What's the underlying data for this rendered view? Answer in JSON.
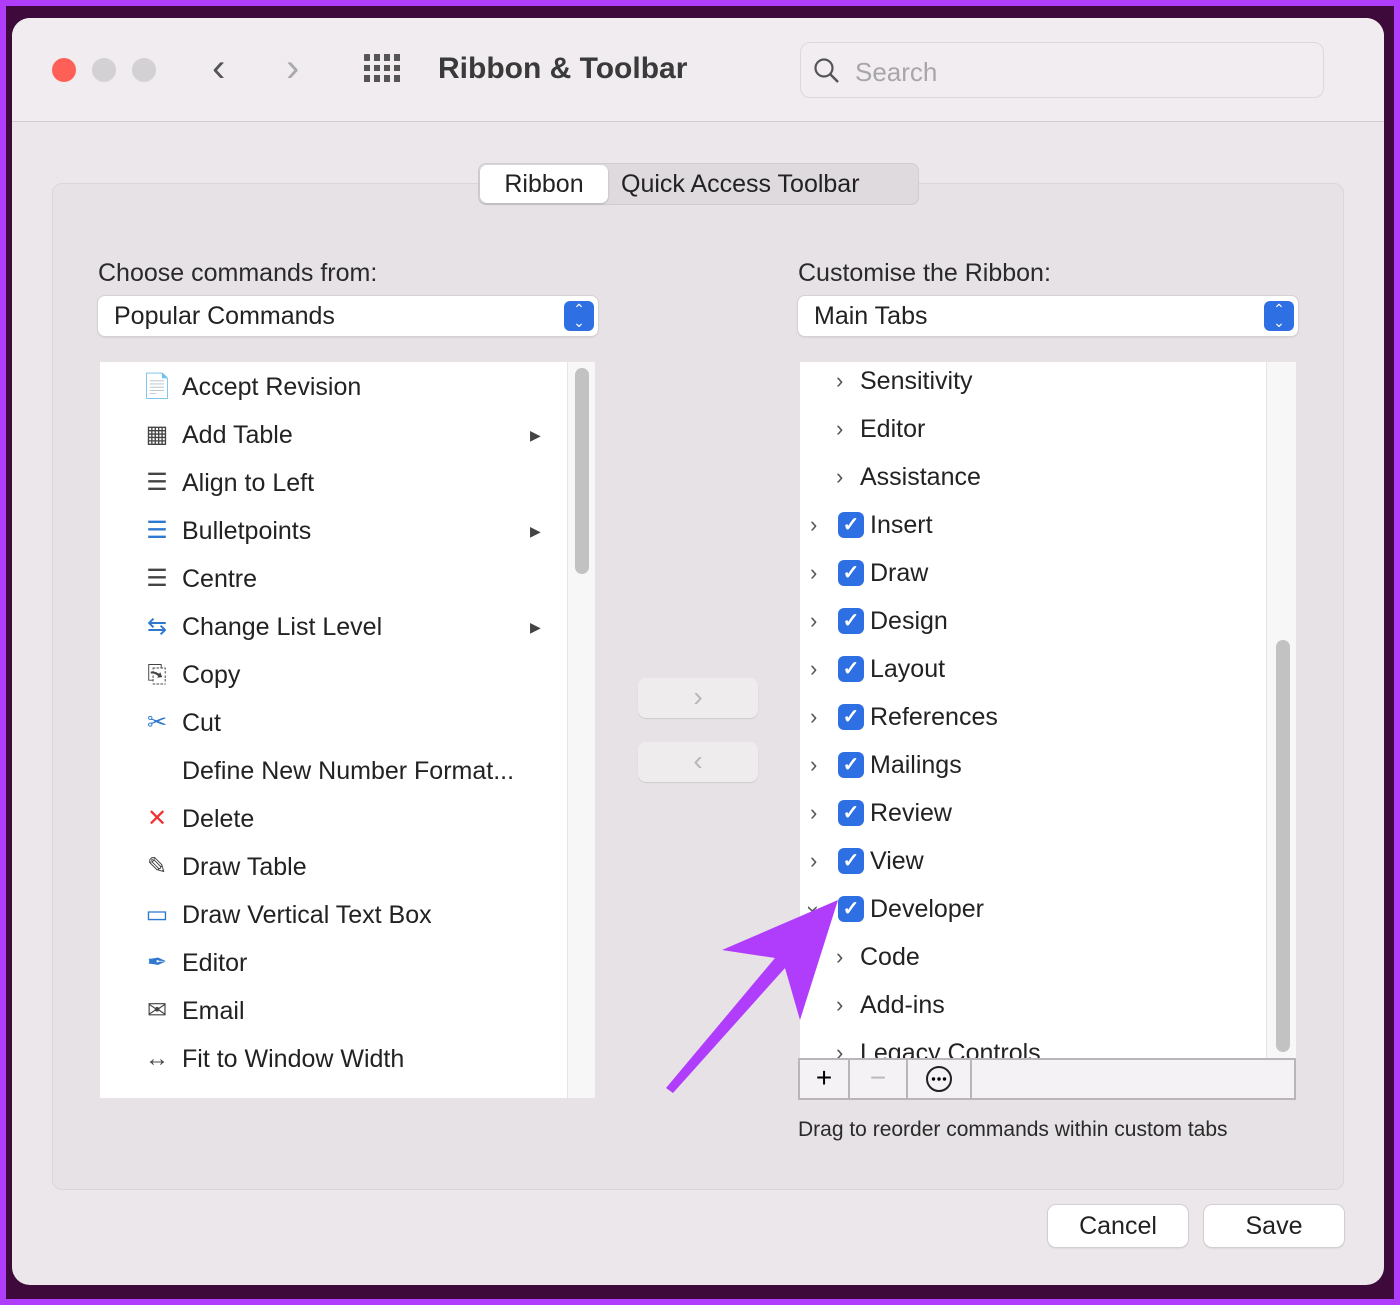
{
  "window": {
    "title": "Ribbon & Toolbar",
    "search_placeholder": "Search"
  },
  "tabs": [
    {
      "label": "Ribbon",
      "selected": true
    },
    {
      "label": "Quick Access Toolbar",
      "selected": false
    }
  ],
  "left": {
    "label": "Choose commands from:",
    "select_value": "Popular Commands",
    "items": [
      {
        "label": "Accept Revision",
        "icon": "accept-revision-icon",
        "submenu": false
      },
      {
        "label": "Add Table",
        "icon": "table-icon",
        "submenu": true
      },
      {
        "label": "Align to Left",
        "icon": "align-left-icon",
        "submenu": false
      },
      {
        "label": "Bulletpoints",
        "icon": "bullet-list-icon",
        "submenu": true
      },
      {
        "label": "Centre",
        "icon": "align-center-icon",
        "submenu": false
      },
      {
        "label": "Change List Level",
        "icon": "list-level-icon",
        "submenu": true
      },
      {
        "label": "Copy",
        "icon": "copy-icon",
        "submenu": false
      },
      {
        "label": "Cut",
        "icon": "scissors-icon",
        "submenu": false
      },
      {
        "label": "Define New Number Format...",
        "icon": "",
        "submenu": false
      },
      {
        "label": "Delete",
        "icon": "delete-comment-icon",
        "submenu": false
      },
      {
        "label": "Draw Table",
        "icon": "draw-table-icon",
        "submenu": false
      },
      {
        "label": "Draw Vertical Text Box",
        "icon": "vertical-text-box-icon",
        "submenu": false
      },
      {
        "label": "Editor",
        "icon": "editor-pen-icon",
        "submenu": false
      },
      {
        "label": "Email",
        "icon": "email-icon",
        "submenu": false
      },
      {
        "label": "Fit to Window Width",
        "icon": "fit-width-icon",
        "submenu": false
      }
    ]
  },
  "right": {
    "label": "Customise the Ribbon:",
    "select_value": "Main Tabs",
    "items": [
      {
        "label": "Sensitivity",
        "level": 1,
        "checked": null,
        "expanded": false
      },
      {
        "label": "Editor",
        "level": 1,
        "checked": null,
        "expanded": false
      },
      {
        "label": "Assistance",
        "level": 1,
        "checked": null,
        "expanded": false
      },
      {
        "label": "Insert",
        "level": 0,
        "checked": true,
        "expanded": false
      },
      {
        "label": "Draw",
        "level": 0,
        "checked": true,
        "expanded": false
      },
      {
        "label": "Design",
        "level": 0,
        "checked": true,
        "expanded": false
      },
      {
        "label": "Layout",
        "level": 0,
        "checked": true,
        "expanded": false
      },
      {
        "label": "References",
        "level": 0,
        "checked": true,
        "expanded": false
      },
      {
        "label": "Mailings",
        "level": 0,
        "checked": true,
        "expanded": false
      },
      {
        "label": "Review",
        "level": 0,
        "checked": true,
        "expanded": false
      },
      {
        "label": "View",
        "level": 0,
        "checked": true,
        "expanded": false
      },
      {
        "label": "Developer",
        "level": 0,
        "checked": true,
        "expanded": true
      },
      {
        "label": "Code",
        "level": 1,
        "checked": null,
        "expanded": false
      },
      {
        "label": "Add-ins",
        "level": 1,
        "checked": null,
        "expanded": false
      },
      {
        "label": "Legacy Controls",
        "level": 1,
        "checked": null,
        "expanded": false
      }
    ],
    "hint": "Drag to reorder commands within custom tabs"
  },
  "buttons": {
    "cancel": "Cancel",
    "save": "Save"
  },
  "colors": {
    "accent": "#2f6fe4",
    "annotation_arrow": "#b03cfc",
    "close": "#fe5f57"
  }
}
